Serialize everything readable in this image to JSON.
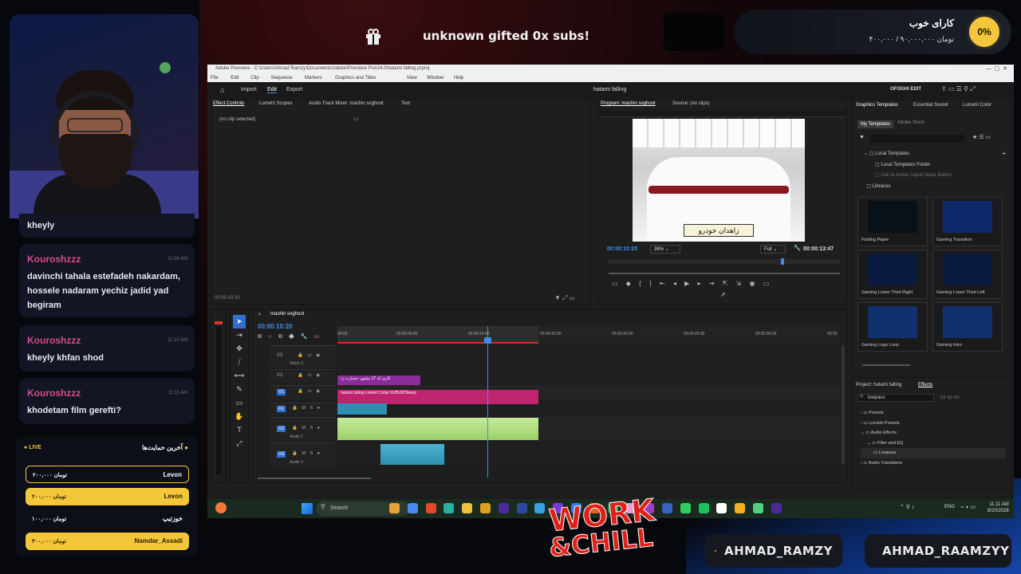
{
  "overlay": {
    "gift_banner": "unknown gifted 0x subs!",
    "goal_title": "کارای خوب",
    "goal_amount": "۴۰۰,۰۰۰ / ۹۰,۰۰۰,۰۰۰ تومان",
    "goal_percent": "0%",
    "goal_progress": 0,
    "logo_line1": "WORK",
    "logo_line2": "&CHILL",
    "youtube_handle": "AHMAD_RAMZY",
    "instagram_handle": "AHMAD_RAAMZYY"
  },
  "chat": [
    {
      "user": "",
      "time": "",
      "message": "kheyly"
    },
    {
      "user": "Kouroshzzz",
      "time": "11:08 AM",
      "message": "davinchi tahala estefadeh nakardam, hossele nadaram yechiz jadid yad begiram"
    },
    {
      "user": "Kouroshzzz",
      "time": "11:10 AM",
      "message": "kheyly khfan shod"
    },
    {
      "user": "Kouroshzzz",
      "time": "11:11 AM",
      "message": "khodetam film gerefti?"
    }
  ],
  "donations": {
    "live_label": "LIVE",
    "title": "آخرین حمایت‌ها",
    "rows": [
      {
        "name": "Levon",
        "amount": "۲۰۰,۰۰۰ تومان",
        "highlight": false
      },
      {
        "name": "Levon",
        "amount": "۲۰۰,۰۰۰ تومان",
        "highlight": true
      },
      {
        "name": "خوزتیپ",
        "amount": "۱۰۰,۰۰۰ تومان",
        "highlight": false
      },
      {
        "name": "Namdar_Assadi",
        "amount": "۳۰۰,۰۰۰ تومان",
        "highlight": true
      }
    ]
  },
  "premiere": {
    "title_path": "Adobe Premiere - C:\\Users\\Ahmad Ramzy\\Documents\\Adobe\\Premiere Pro\\24.0\\hatami falling.prproj",
    "menu": [
      "File",
      "Edit",
      "Clip",
      "Sequence",
      "Markers",
      "Graphics and Titles",
      "View",
      "Window",
      "Help"
    ],
    "nav": [
      "Import",
      "Edit",
      "Export"
    ],
    "project_name": "hatami falling",
    "workspace": "OFOGHI EDIT",
    "left_tabs": [
      "Effect Controls",
      "Lumetri Scopes",
      "Audio Track Mixer: mashin soghoot",
      "Text"
    ],
    "no_clip": "(no clip selected)",
    "ec_time": "00:00:10:20",
    "program_tab": "Program: mashin soghoot",
    "source_tab": "Source: (no clips)",
    "plate_text": "زاهدان خودرو",
    "program_time": "00:00:10:20",
    "zoom": "38%",
    "resolution": "Full",
    "duration": "00:00:13:47",
    "right_tabs": [
      "Graphics Templates",
      "Essential Sound",
      "Lumetri Color"
    ],
    "templates_subtabs": [
      "My Templates",
      "Adobe Stock"
    ],
    "templates_tree": [
      "Local Templates",
      "Local Templates Folder",
      "Call to Action Liquid Glass Button",
      "Libraries"
    ],
    "templates": [
      "Folding Paper",
      "Gaming Transition",
      "Gaming Lower Third Right",
      "Gaming Lower Third Left",
      "Gaming Logo Loop",
      "Gaming Intro"
    ],
    "effects_tabs": [
      "Project: hatami falling",
      "Effects"
    ],
    "effects_search": "lowpass",
    "effects_tree": [
      "Presets",
      "Lumetri Presets",
      "Audio Effects",
      "Filter and EQ",
      "Lowpass",
      "Audio Transitions"
    ],
    "sequence_name": "mashin soghoot",
    "timeline_time": "00:00:10:20",
    "ruler": [
      "00:00",
      "00:00:05:00",
      "00:00:10:00",
      "00:00:15:00",
      "00:00:20:00",
      "00:00:25:00",
      "00:00:30:00",
      "00:00"
    ],
    "tracks": [
      "V3",
      "V2",
      "V1",
      "A1",
      "A2",
      "A3"
    ],
    "track_names": [
      "Video 3",
      "Audio 2",
      "Audio 3"
    ],
    "clip_v2": "کاری که 17 میلیون خسارت زد",
    "clip_v1": "hatami falling Linked Comp 01/ff18f23keep"
  },
  "taskbar": {
    "search": "Search",
    "lang": "ENG",
    "time": "11:11 AM",
    "date": "8/20/2026"
  },
  "colors": {
    "accent_pink": "#d94b8a",
    "donation_yellow": "#f4c63a",
    "clip_magenta": "#c0246e",
    "clip_purple": "#8a2c9a",
    "audio_green": "#9ad06a",
    "audio_teal": "#2f8fb0",
    "playhead_blue": "#3a8ee6"
  }
}
